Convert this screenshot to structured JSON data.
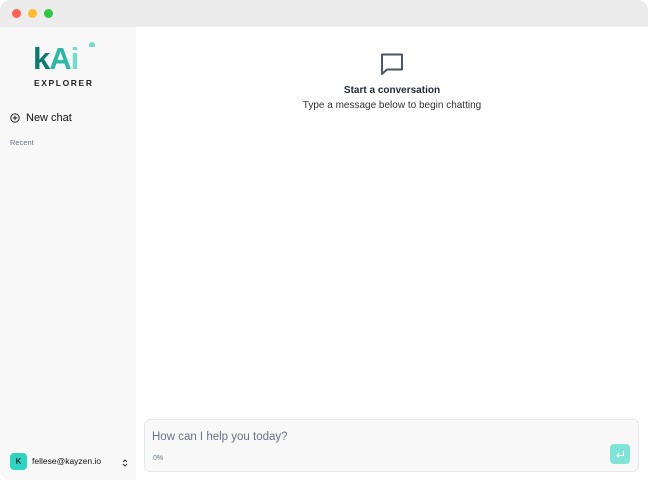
{
  "window": {
    "controls": [
      "close",
      "minimize",
      "maximize"
    ]
  },
  "sidebar": {
    "logo": {
      "wordmark": "kAi",
      "tagline": "EXPLORER"
    },
    "new_chat": {
      "label": "New chat",
      "icon": "plus-circle-icon"
    },
    "recent_label": "Recent",
    "recent_items": [],
    "user": {
      "avatar_initial": "K",
      "email": "fellese@kayzen.io",
      "menu_icon": "chevron-up-down-icon"
    }
  },
  "main": {
    "empty_state": {
      "icon": "chat-bubble-icon",
      "title": "Start a conversation",
      "subtitle": "Type a message below to begin chatting"
    },
    "composer": {
      "placeholder": "How can I help you today?",
      "value": "",
      "usage": "0%",
      "send_icon": "enter-icon"
    }
  },
  "colors": {
    "accent": "#2dd4bf",
    "send_button": "#7fe3d6",
    "logo_dark": "#0e7a6d",
    "logo_mid": "#2bb8a6",
    "logo_light": "#6fdccc",
    "sidebar_bg": "#f8f8f8"
  }
}
